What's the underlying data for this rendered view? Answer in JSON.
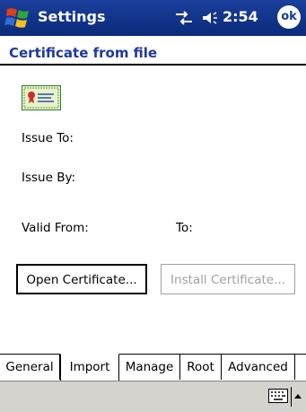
{
  "titlebar": {
    "title": "Settings",
    "time": "2:54",
    "ok_label": "ok",
    "icons": [
      "start-flag-icon",
      "connectivity-icon",
      "volume-icon"
    ]
  },
  "header": {
    "title": "Certificate from file"
  },
  "cert": {
    "icon": "certificate-icon",
    "issue_to_label": "Issue To:",
    "issue_by_label": "Issue By:",
    "valid_from_label": "Valid From:",
    "to_label": "To:"
  },
  "buttons": {
    "open": "Open Certificate...",
    "install": "Install Certificate..."
  },
  "tabs": [
    {
      "label": "General"
    },
    {
      "label": "Import"
    },
    {
      "label": "Manage"
    },
    {
      "label": "Root"
    },
    {
      "label": "Advanced"
    }
  ],
  "active_tab": "Import",
  "menubar": {
    "icons": [
      "keyboard-icon",
      "sip-up-arrow-icon"
    ]
  },
  "colors": {
    "titlebar": "#0a2a7a",
    "header_text": "#1e3a9a",
    "menubar": "#d6d3ce",
    "disabled_text": "#a0a0a0"
  }
}
